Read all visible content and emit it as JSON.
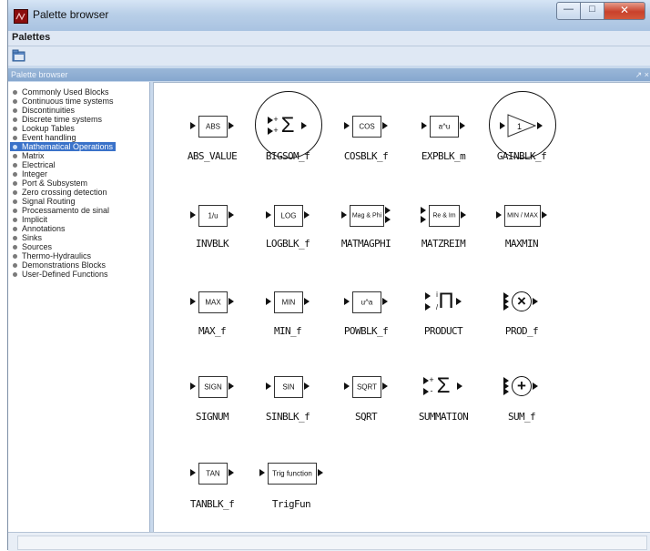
{
  "window": {
    "title": "Palette browser"
  },
  "menu": {
    "items": [
      "Palettes"
    ]
  },
  "toolbar": {
    "open_icon": "folder-icon"
  },
  "panel": {
    "title": "Palette browser",
    "close_glyph": "↗ ×"
  },
  "tree": {
    "items": [
      "Commonly Used Blocks",
      "Continuous time systems",
      "Discontinuities",
      "Discrete time systems",
      "Lookup Tables",
      "Event handling",
      "Mathematical Operations",
      "Matrix",
      "Electrical",
      "Integer",
      "Port & Subsystem",
      "Zero crossing detection",
      "Signal Routing",
      "Processamento de sinal",
      "Implicit",
      "Annotations",
      "Sinks",
      "Sources",
      "Thermo-Hydraulics",
      "Demonstrations Blocks",
      "User-Defined Functions"
    ],
    "selected": "Mathematical Operations"
  },
  "blocks": [
    {
      "name": "ABS_VALUE",
      "label": "ABS"
    },
    {
      "name": "BIGSOM_f",
      "label": "Σ",
      "highlighted": true
    },
    {
      "name": "COSBLK_f",
      "label": "COS"
    },
    {
      "name": "EXPBLK_m",
      "label": "a^u"
    },
    {
      "name": "GAINBLK_f",
      "label": "1",
      "highlighted": true
    },
    {
      "name": "INVBLK",
      "label": "1/u"
    },
    {
      "name": "LOGBLK_f",
      "label": "LOG"
    },
    {
      "name": "MATMAGPHI",
      "label": "Mag & Phi"
    },
    {
      "name": "MATZREIM",
      "label": "Re & Im"
    },
    {
      "name": "MAXMIN",
      "label": "MIN / MAX"
    },
    {
      "name": "MAX_f",
      "label": "MAX"
    },
    {
      "name": "MIN_f",
      "label": "MIN"
    },
    {
      "name": "POWBLK_f",
      "label": "u^a"
    },
    {
      "name": "PRODUCT",
      "label": "Π"
    },
    {
      "name": "PROD_f",
      "label": "×"
    },
    {
      "name": "SIGNUM",
      "label": "SIGN"
    },
    {
      "name": "SINBLK_f",
      "label": "SIN"
    },
    {
      "name": "SQRT",
      "label": "SQRT"
    },
    {
      "name": "SUMMATION",
      "label": "Σ"
    },
    {
      "name": "SUM_f",
      "label": "+"
    },
    {
      "name": "TANBLK_f",
      "label": "TAN"
    },
    {
      "name": "TrigFun",
      "label": "Trig function"
    }
  ]
}
